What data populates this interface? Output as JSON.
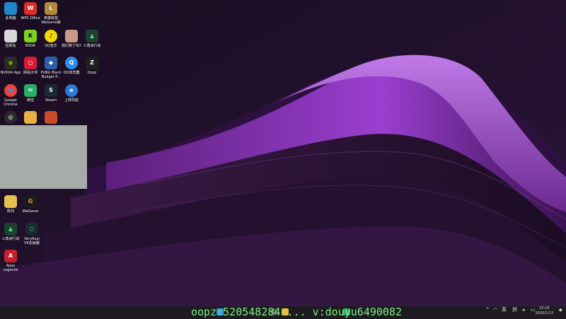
{
  "desktop": {
    "icons": [
      {
        "label": "此电脑",
        "icon": "computer-icon",
        "color": "#1e88c8",
        "glyph": ""
      },
      {
        "label": "WPS Office",
        "icon": "wps-icon",
        "color": "#e02c2c",
        "glyph": "W"
      },
      {
        "label": "英雄联盟WeGame版",
        "icon": "lol-icon",
        "color": "#b08a3a",
        "glyph": "L"
      },
      {
        "label": "回收站",
        "icon": "recycle-bin-icon",
        "color": "#d8d8d8",
        "glyph": ""
      },
      {
        "label": "KOOK",
        "icon": "kook-icon",
        "color": "#7ed321",
        "glyph": "K"
      },
      {
        "label": "QQ音乐",
        "icon": "qq-music-icon",
        "color": "#f5d800",
        "glyph": "♪"
      },
      {
        "label": "我们到了吗?",
        "icon": "game-icon",
        "color": "#c89b84",
        "glyph": ""
      },
      {
        "label": "三角洲行动",
        "icon": "delta-force-icon",
        "color": "#1f4030",
        "glyph": "▲"
      },
      {
        "label": "NVIDIA App",
        "icon": "nvidia-icon",
        "color": "#2a2a2a",
        "glyph": "◉"
      },
      {
        "label": "网易大师",
        "icon": "netease-icon",
        "color": "#d81b3a",
        "glyph": "○"
      },
      {
        "label": "PUBG Black Budget P...",
        "icon": "pubg-icon",
        "color": "#2b5fa6",
        "glyph": "◆"
      },
      {
        "label": "QQ浏览器",
        "icon": "qq-browser-icon",
        "color": "#2d8cf0",
        "glyph": "Q"
      },
      {
        "label": "Oopz",
        "icon": "oopz-icon",
        "color": "#202020",
        "glyph": "Z"
      },
      {
        "label": "Google Chrome",
        "icon": "chrome-icon",
        "color": "#e8453c",
        "glyph": "●"
      },
      {
        "label": "微信",
        "icon": "wechat-icon",
        "color": "#2aae67",
        "glyph": "✉"
      },
      {
        "label": "Steam",
        "icon": "steam-icon",
        "color": "#1b2838",
        "glyph": "S"
      },
      {
        "label": "上网导航",
        "icon": "ie-icon",
        "color": "#2a7bd4",
        "glyph": "e"
      },
      {
        "label": "",
        "icon": "obs-icon",
        "color": "#2a2a2a",
        "glyph": "◎"
      },
      {
        "label": "",
        "icon": "folder-icon",
        "color": "#e8b040",
        "glyph": ""
      },
      {
        "label": "",
        "icon": "tiger-icon",
        "color": "#c94a2c",
        "glyph": ""
      },
      {
        "label": "陈列",
        "icon": "folder-icon",
        "color": "#e8c050",
        "glyph": ""
      },
      {
        "label": "WeGame",
        "icon": "wegame-icon",
        "color": "#1a1a1a",
        "glyph": "G"
      },
      {
        "label": "三角洲行动",
        "icon": "delta-force-icon",
        "color": "#1f4030",
        "glyph": "▲"
      },
      {
        "label": "VeryKuai VK加速器",
        "icon": "vk-icon",
        "color": "#1a2a2a",
        "glyph": "⬡"
      },
      {
        "label": "Apex Legends",
        "icon": "apex-icon",
        "color": "#c8202a",
        "glyph": "A"
      }
    ]
  },
  "watermark": {
    "text": "oopz:520548284 ... v:douyu6490082"
  },
  "tray": {
    "lang": "英",
    "ime": "拼"
  },
  "clock": {
    "time": "23:29",
    "date": "2026/1/13"
  }
}
